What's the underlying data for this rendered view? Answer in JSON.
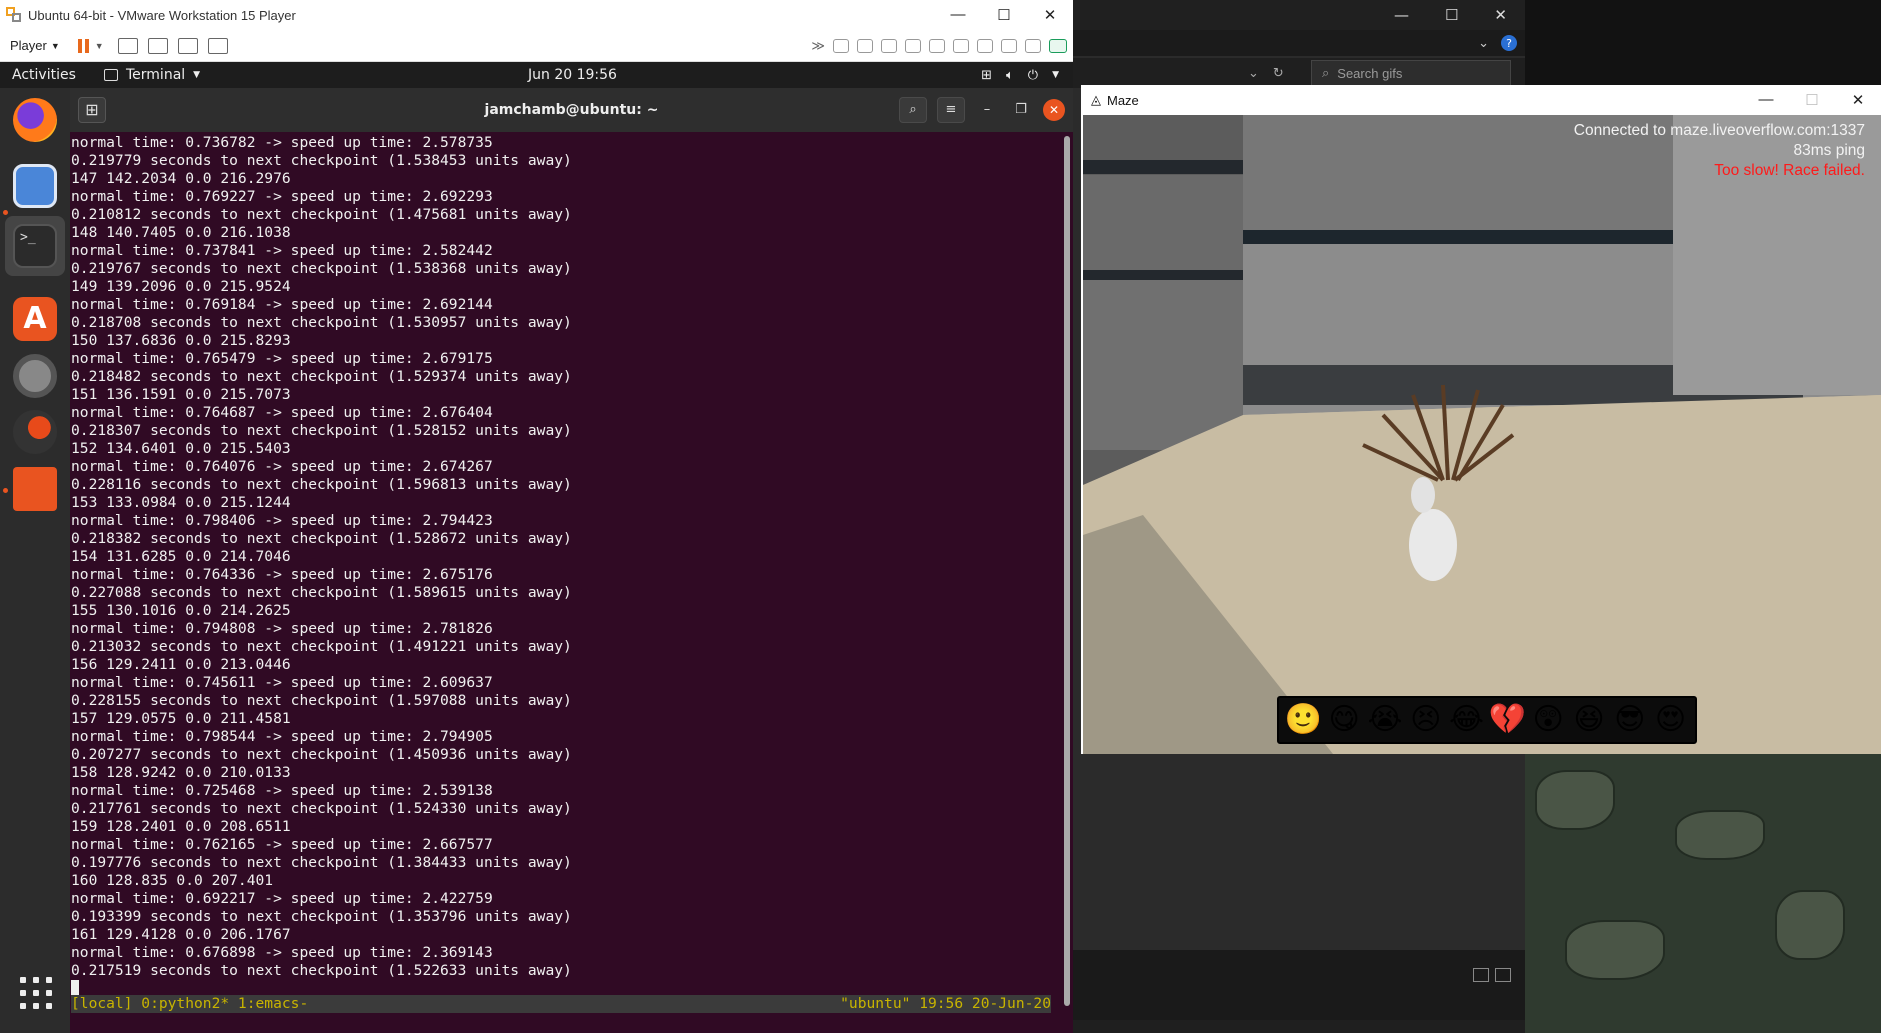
{
  "vmware": {
    "title": "Ubuntu 64-bit - VMware Workstation 15 Player",
    "player_label": "Player",
    "win_min": "—",
    "win_max": "☐",
    "win_close": "✕"
  },
  "ubuntu_bar": {
    "activities": "Activities",
    "app_menu": "Terminal",
    "clock": "Jun 20  19:56"
  },
  "terminal": {
    "title": "jamchamb@ubuntu: ~",
    "lines": [
      "normal time: 0.736782 -> speed up time: 2.578735",
      "0.219779 seconds to next checkpoint (1.538453 units away)",
      "147 142.2034 0.0 216.2976",
      "normal time: 0.769227 -> speed up time: 2.692293",
      "0.210812 seconds to next checkpoint (1.475681 units away)",
      "148 140.7405 0.0 216.1038",
      "normal time: 0.737841 -> speed up time: 2.582442",
      "0.219767 seconds to next checkpoint (1.538368 units away)",
      "149 139.2096 0.0 215.9524",
      "normal time: 0.769184 -> speed up time: 2.692144",
      "0.218708 seconds to next checkpoint (1.530957 units away)",
      "150 137.6836 0.0 215.8293",
      "normal time: 0.765479 -> speed up time: 2.679175",
      "0.218482 seconds to next checkpoint (1.529374 units away)",
      "151 136.1591 0.0 215.7073",
      "normal time: 0.764687 -> speed up time: 2.676404",
      "0.218307 seconds to next checkpoint (1.528152 units away)",
      "152 134.6401 0.0 215.5403",
      "normal time: 0.764076 -> speed up time: 2.674267",
      "0.228116 seconds to next checkpoint (1.596813 units away)",
      "153 133.0984 0.0 215.1244",
      "normal time: 0.798406 -> speed up time: 2.794423",
      "0.218382 seconds to next checkpoint (1.528672 units away)",
      "154 131.6285 0.0 214.7046",
      "normal time: 0.764336 -> speed up time: 2.675176",
      "0.227088 seconds to next checkpoint (1.589615 units away)",
      "155 130.1016 0.0 214.2625",
      "normal time: 0.794808 -> speed up time: 2.781826",
      "0.213032 seconds to next checkpoint (1.491221 units away)",
      "156 129.2411 0.0 213.0446",
      "normal time: 0.745611 -> speed up time: 2.609637",
      "0.228155 seconds to next checkpoint (1.597088 units away)",
      "157 129.0575 0.0 211.4581",
      "normal time: 0.798544 -> speed up time: 2.794905",
      "0.207277 seconds to next checkpoint (1.450936 units away)",
      "158 128.9242 0.0 210.0133",
      "normal time: 0.725468 -> speed up time: 2.539138",
      "0.217761 seconds to next checkpoint (1.524330 units away)",
      "159 128.2401 0.0 208.6511",
      "normal time: 0.762165 -> speed up time: 2.667577",
      "0.197776 seconds to next checkpoint (1.384433 units away)",
      "160 128.835 0.0 207.401",
      "normal time: 0.692217 -> speed up time: 2.422759",
      "0.193399 seconds to next checkpoint (1.353796 units away)",
      "161 129.4128 0.0 206.1767",
      "normal time: 0.676898 -> speed up time: 2.369143",
      "0.217519 seconds to next checkpoint (1.522633 units away)"
    ],
    "status_left": "[local] 0:python2* 1:emacs-",
    "status_right": "\"ubuntu\" 19:56 20-Jun-20"
  },
  "maze": {
    "title": "Maze",
    "hud_connected": "Connected to maze.liveoverflow.com:1337",
    "hud_ping": "83ms ping",
    "hud_fail": "Too slow! Race failed.",
    "emojis": [
      "🙂",
      "😋",
      "😭",
      "😣",
      "😂",
      "💔",
      "😲",
      "😆",
      "😎",
      "😍"
    ]
  },
  "explorer": {
    "search_placeholder": "Search gifs",
    "help": "?"
  },
  "colors": {
    "terminal_bg": "#300a24",
    "ubuntu_orange": "#e95420",
    "tmux_status_fg": "#c8b400",
    "hud_fail": "#ff1a1a"
  }
}
